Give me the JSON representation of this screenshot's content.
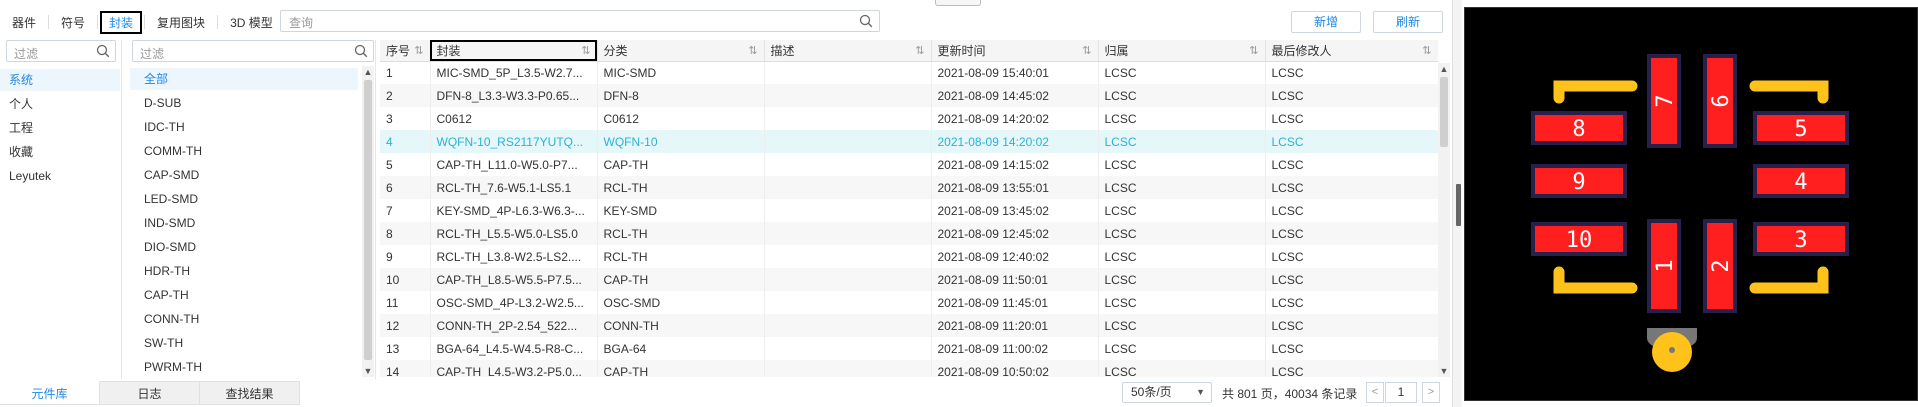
{
  "toolbar": {
    "tabs": [
      "器件",
      "符号",
      "封装",
      "复用图块",
      "3D 模型"
    ],
    "search_placeholder": "查询",
    "add_label": "新增",
    "refresh_label": "刷新"
  },
  "category": {
    "filter_placeholder": "过滤",
    "items": [
      "系统",
      "个人",
      "工程",
      "收藏",
      "Leyutek"
    ]
  },
  "packages": {
    "filter_placeholder": "过滤",
    "items": [
      "全部",
      "D-SUB",
      "IDC-TH",
      "COMM-TH",
      "CAP-SMD",
      "LED-SMD",
      "IND-SMD",
      "DIO-SMD",
      "HDR-TH",
      "CAP-TH",
      "CONN-TH",
      "SW-TH",
      "PWRM-TH"
    ]
  },
  "table": {
    "columns": [
      "序号",
      "封装",
      "分类",
      "描述",
      "更新时间",
      "归属",
      "最后修改人"
    ],
    "sort_icon": "⇅",
    "rows": [
      [
        "1",
        "MIC-SMD_5P_L3.5-W2.7...",
        "MIC-SMD",
        "",
        "2021-08-09 15:40:01",
        "LCSC",
        "LCSC"
      ],
      [
        "2",
        "DFN-8_L3.3-W3.3-P0.65...",
        "DFN-8",
        "",
        "2021-08-09 14:45:02",
        "LCSC",
        "LCSC"
      ],
      [
        "3",
        "C0612",
        "C0612",
        "",
        "2021-08-09 14:20:02",
        "LCSC",
        "LCSC"
      ],
      [
        "4",
        "WQFN-10_RS2117YUTQ...",
        "WQFN-10",
        "",
        "2021-08-09 14:20:02",
        "LCSC",
        "LCSC"
      ],
      [
        "5",
        "CAP-TH_L11.0-W5.0-P7...",
        "CAP-TH",
        "",
        "2021-08-09 14:15:02",
        "LCSC",
        "LCSC"
      ],
      [
        "6",
        "RCL-TH_7.6-W5.1-LS5.1",
        "RCL-TH",
        "",
        "2021-08-09 13:55:01",
        "LCSC",
        "LCSC"
      ],
      [
        "7",
        "KEY-SMD_4P-L6.3-W6.3-...",
        "KEY-SMD",
        "",
        "2021-08-09 13:45:02",
        "LCSC",
        "LCSC"
      ],
      [
        "8",
        "RCL-TH_L5.5-W5.0-LS5.0",
        "RCL-TH",
        "",
        "2021-08-09 12:45:02",
        "LCSC",
        "LCSC"
      ],
      [
        "9",
        "RCL-TH_L3.8-W2.5-LS2....",
        "RCL-TH",
        "",
        "2021-08-09 12:40:02",
        "LCSC",
        "LCSC"
      ],
      [
        "10",
        "CAP-TH_L8.5-W5.5-P7.5...",
        "CAP-TH",
        "",
        "2021-08-09 11:50:01",
        "LCSC",
        "LCSC"
      ],
      [
        "11",
        "OSC-SMD_4P-L3.2-W2.5...",
        "OSC-SMD",
        "",
        "2021-08-09 11:45:01",
        "LCSC",
        "LCSC"
      ],
      [
        "12",
        "CONN-TH_2P-2.54_522...",
        "CONN-TH",
        "",
        "2021-08-09 11:20:01",
        "LCSC",
        "LCSC"
      ],
      [
        "13",
        "BGA-64_L4.5-W4.5-R8-C...",
        "BGA-64",
        "",
        "2021-08-09 11:00:02",
        "LCSC",
        "LCSC"
      ],
      [
        "14",
        "CAP-TH_L4.5-W3.2-P5.0...",
        "CAP-TH",
        "",
        "2021-08-09 10:50:02",
        "LCSC",
        "LCSC"
      ]
    ]
  },
  "bottom_tabs": [
    "元件库",
    "日志",
    "查找结果"
  ],
  "pagination": {
    "page_size": "50条/页",
    "summary": "共 801 页，40034 条记录",
    "prev": "<",
    "page": "1",
    "next": ">"
  },
  "preview": {
    "pad_labels": [
      "1",
      "2",
      "3",
      "4",
      "5",
      "6",
      "7",
      "8",
      "9",
      "10"
    ],
    "colors": {
      "background": "#000000",
      "pad": "#ff1f1f",
      "silkscreen": "#ffc21a",
      "accent": "#1e88e5",
      "selected_text": "#2bb2d6"
    }
  }
}
